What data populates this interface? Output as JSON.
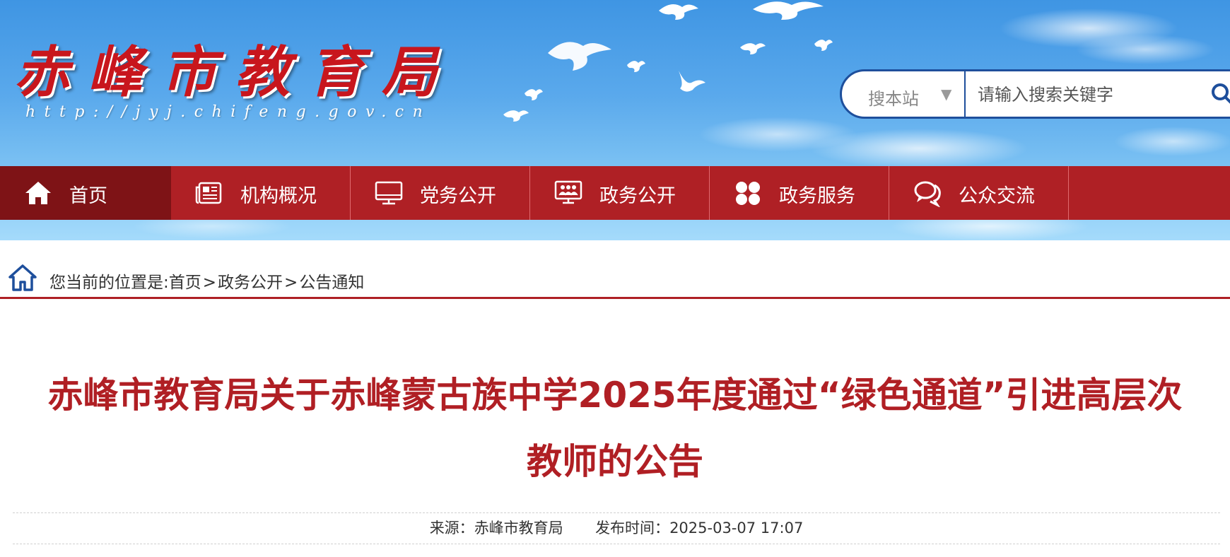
{
  "header": {
    "site_name": "赤峰市教育局",
    "site_url": "http://jyj.chifeng.gov.cn"
  },
  "search": {
    "scope_label": "搜本站",
    "placeholder": "请输入搜索关键字",
    "scope_arrow": "▼",
    "button_icon": "search-icon"
  },
  "nav": {
    "items": [
      {
        "label": "首页",
        "icon": "home-icon",
        "active": true
      },
      {
        "label": "机构概况",
        "icon": "newspaper-icon"
      },
      {
        "label": "党务公开",
        "icon": "monitor-icon"
      },
      {
        "label": "政务公开",
        "icon": "presentation-icon"
      },
      {
        "label": "政务服务",
        "icon": "grid-icon"
      },
      {
        "label": "公众交流",
        "icon": "chat-icon"
      }
    ]
  },
  "breadcrumb": {
    "prefix": "您当前的位置是:",
    "items": [
      "首页",
      "政务公开",
      "公告通知"
    ],
    "separator": ">"
  },
  "article": {
    "title_line1": "赤峰市教育局关于赤峰蒙古族中学2025年度通过“绿色通道”引进高层次",
    "title_line2": "教师的公告",
    "source_label": "来源：",
    "source": "赤峰市教育局",
    "date_label": "发布时间：",
    "date": "2025-03-07 17:07"
  },
  "colors": {
    "brand_red": "#af2025",
    "nav_active": "#7e1316",
    "title_red": "#b01f24",
    "search_border": "#1e4f9c"
  }
}
